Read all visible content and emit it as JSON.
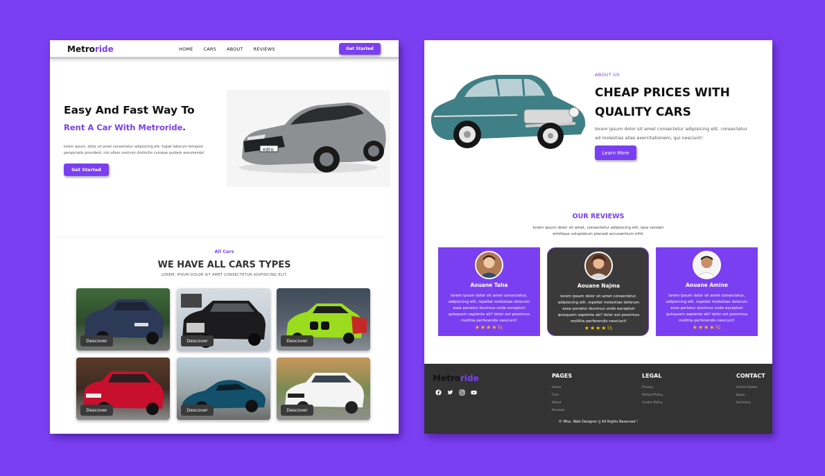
{
  "left": {
    "nav": {
      "logo_main": "Metro",
      "logo_accent": "ride",
      "links": [
        "HOME",
        "CARS",
        "ABOUT",
        "REVIEWS"
      ],
      "cta": "Get Started"
    },
    "hero": {
      "title_line1": "Easy And Fast Way To",
      "title_line2": "Rent A Car With Metroride",
      "title_dot": ".",
      "paragraph": "lorem ipsum, dolor sit amet consectetur adipisicing elit. fugiat laborum tempore perspiciatis provident, nisi ullam nostrum distinctio cumque quidem assumenda!",
      "cta": "Get Started"
    },
    "cars": {
      "small": "All Cars",
      "title": "WE HAVE ALL CARS TYPES",
      "subtitle": "LOREM, IPSUM DOLOR SIT AMET CONSECTETUR ADIPISICING ELIT.",
      "button_label": "Descover"
    }
  },
  "right": {
    "about": {
      "small": "ABOUT US",
      "title_line1": "CHEAP PRICES WITH",
      "title_line2": "QUALITY CARS",
      "paragraph": "lorem ipsum dolor sit amet consectetur adipisicing elit. consectetur ad molestias alias exercitationem, qui nesciunt!",
      "cta": "Learn More"
    },
    "reviews": {
      "title": "OUR REVIEWS",
      "subtitle": "lorem ipsum dolor sit amet, consectetur adipisicing elit. ipsa veniam similique voluptatum placeat accusantium nihil.",
      "cards": [
        {
          "name": "Aouane Taha",
          "text": "lorem ipsum dolor sit amet consectetur, adipisicing elit. repellat molestiae dolorum esse pariatur ducimus unde excepturi quisquam sapiente ab? dolor est possimus mollitia perferendis nesciunt!",
          "stars": "★★★★½",
          "rating": 4.5
        },
        {
          "name": "Aouane Najma",
          "text": "lorem ipsum dolor sit amet consectetur, adipisicing elit. repellat molestiae dolorum esse pariatur ducimus unde excepturi quisquam sapiente ab? dolor est possimus mollitia perferendis nesciunt!",
          "stars": "★★★★½",
          "rating": 4.5
        },
        {
          "name": "Aouane Amine",
          "text": "lorem ipsum dolor sit amet consectetur, adipisicing elit. repellat molestiae dolorum esse pariatur ducimus unde excepturi quisquam sapiente ab? dolor est possimus mollitia perferendis nesciunt!",
          "stars": "★★★★½",
          "rating": 4.5
        }
      ]
    },
    "footer": {
      "logo_main": "Metro",
      "logo_accent": "ride",
      "social_icons": [
        "facebook-icon",
        "twitter-icon",
        "instagram-icon",
        "youtube-icon"
      ],
      "pages_title": "PAGES",
      "pages": [
        "Home",
        "Cars",
        "About",
        "Reviews"
      ],
      "legal_title": "LEGAL",
      "legal": [
        "Privacy",
        "Refund Policy",
        "Cookie Policy"
      ],
      "contact_title": "CONTACT",
      "contact": [
        "United States",
        "Japan",
        "Germany"
      ],
      "copyright": "© Miss. Web Designer || All Rights Reserved !"
    }
  },
  "colors": {
    "accent": "#7b3ff2",
    "dark": "#333333",
    "card_dark": "#3a3a3a",
    "star": "#ffc107"
  }
}
